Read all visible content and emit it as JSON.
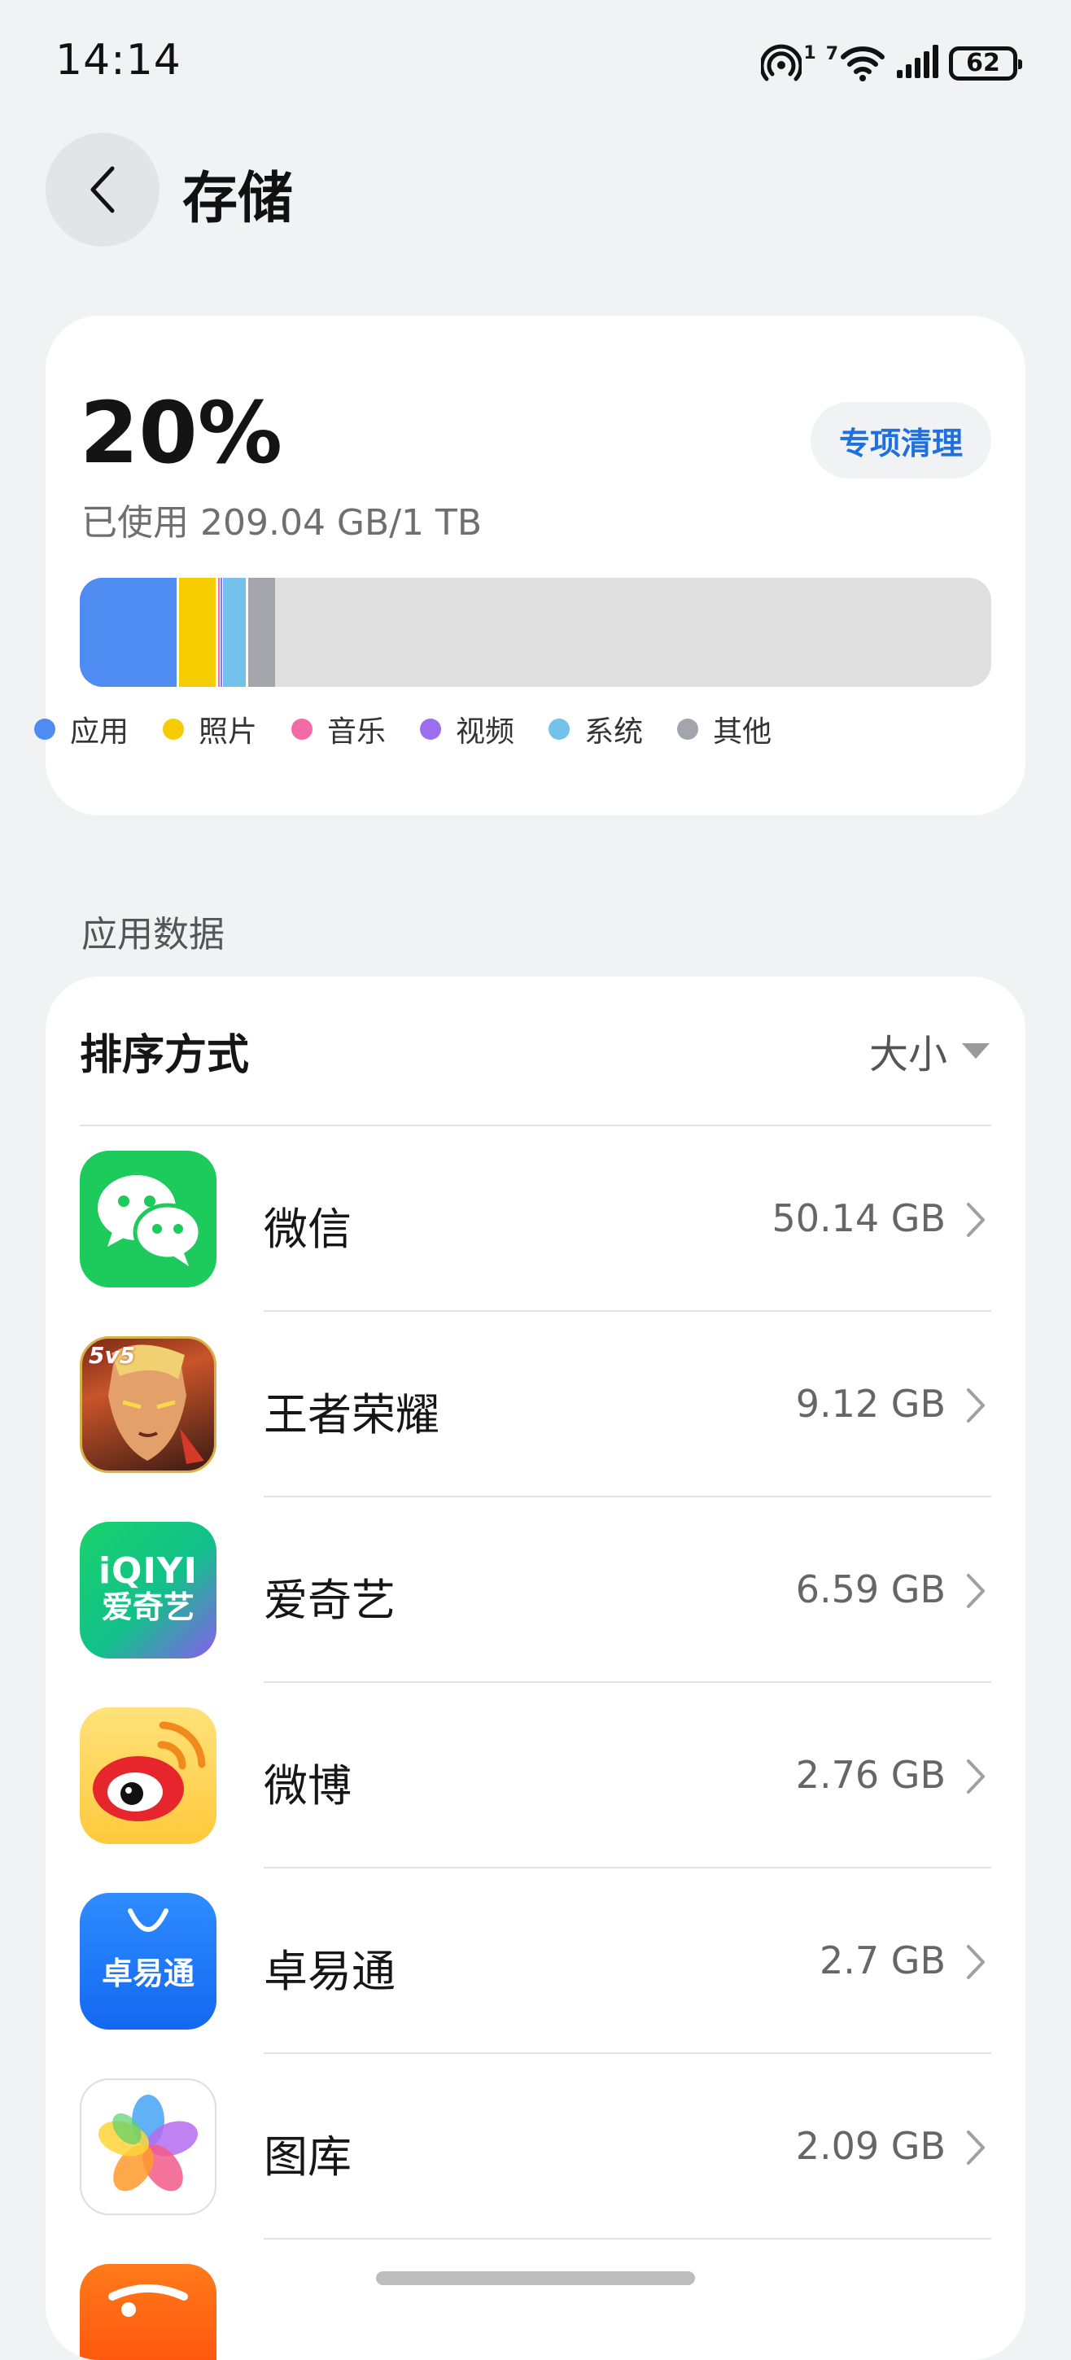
{
  "status_bar": {
    "time": "14:14",
    "hotspot_sup": "1",
    "wifi_sup": "7",
    "battery": "62"
  },
  "header": {
    "title": "存储"
  },
  "storage": {
    "percent": "20%",
    "used_text": "已使用 209.04 GB/1 TB",
    "clean_button": "专项清理",
    "legend": [
      {
        "label": "应用",
        "color": "#4f8cf2"
      },
      {
        "label": "照片",
        "color": "#f5cc00"
      },
      {
        "label": "音乐",
        "color": "#f26aa6"
      },
      {
        "label": "视频",
        "color": "#9b6ff0"
      },
      {
        "label": "系统",
        "color": "#72c2ec"
      },
      {
        "label": "其他",
        "color": "#a4a4ad"
      }
    ]
  },
  "app_data": {
    "section_title": "应用数据",
    "sort_label": "排序方式",
    "sort_value": "大小",
    "apps": [
      {
        "name": "微信",
        "size": "50.14 GB"
      },
      {
        "name": "王者荣耀",
        "size": "9.12 GB"
      },
      {
        "name": "爱奇艺",
        "size": "6.59 GB"
      },
      {
        "name": "微博",
        "size": "2.76 GB"
      },
      {
        "name": "卓易通",
        "size": "2.7 GB"
      },
      {
        "name": "图库",
        "size": "2.09 GB"
      }
    ],
    "icon_texts": {
      "game_badge": "5v5",
      "iqiyi_top": "iQIYI",
      "iqiyi_bottom": "爱奇艺",
      "zhuoyitong": "卓易通"
    }
  }
}
